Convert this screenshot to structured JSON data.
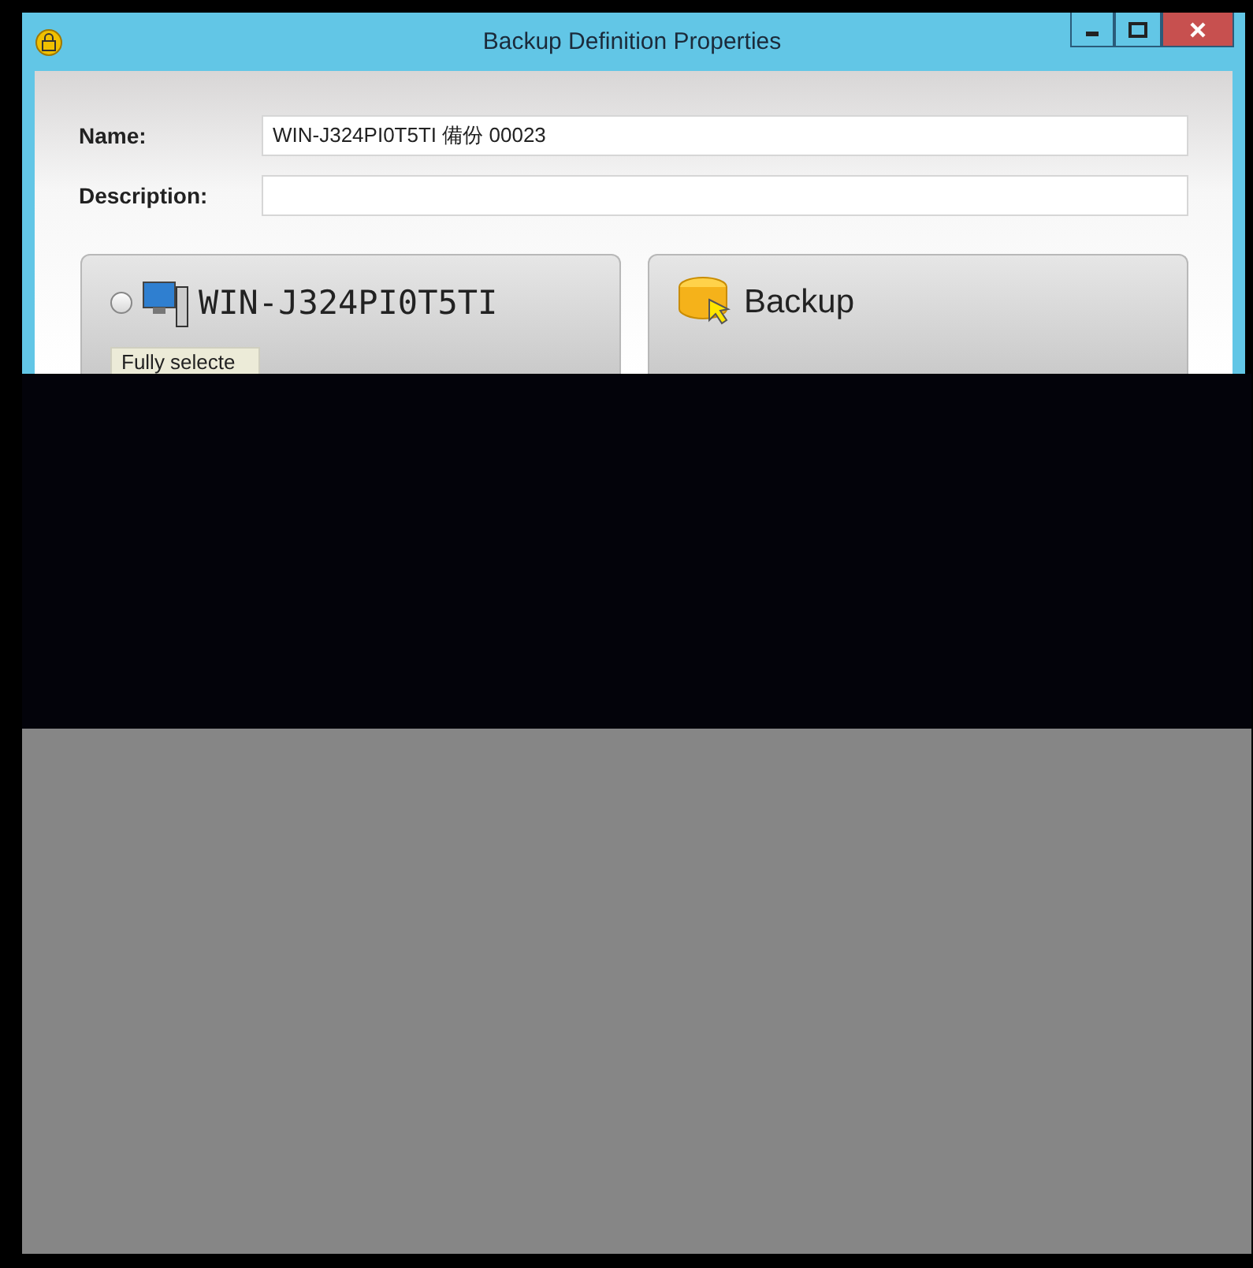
{
  "window": {
    "title": "Backup Definition Properties"
  },
  "fields": [
    {
      "label": "Name:",
      "value": "WIN-J324PI0T5TI 備份 00023"
    },
    {
      "label": "Description:"
    }
  ],
  "panels": [
    {
      "kind": "computer",
      "selected": false,
      "title": "WIN-J324PI0T5TI",
      "status": "Fully selecte"
    },
    {
      "kind": "backup",
      "title": "Backup"
    }
  ]
}
